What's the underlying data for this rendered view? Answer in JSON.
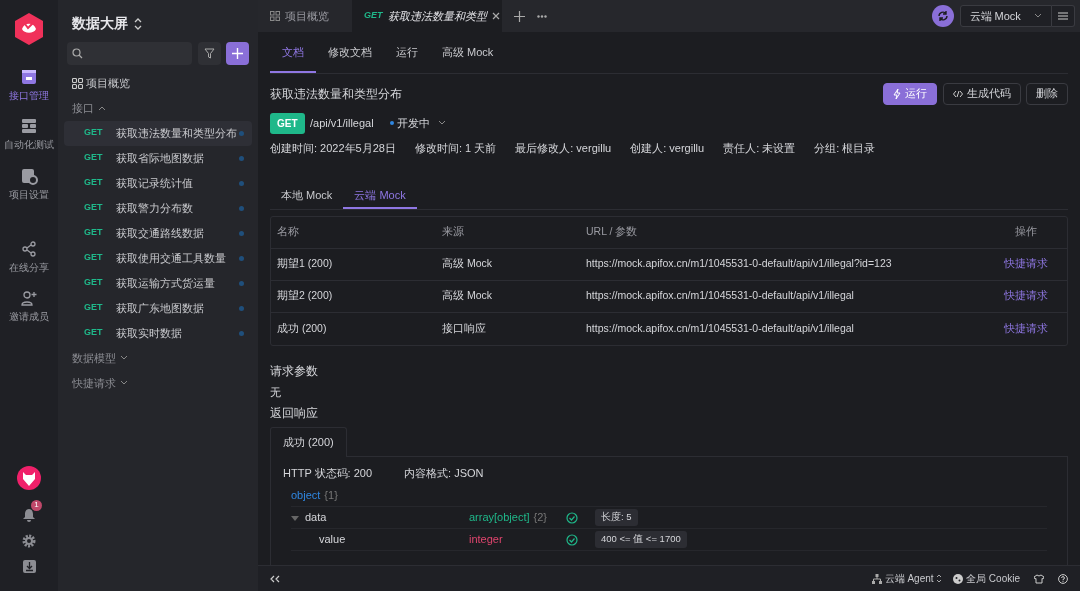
{
  "rail": {
    "items": [
      {
        "label": "接口管理",
        "selected": true
      },
      {
        "label": "自动化测试",
        "selected": false
      },
      {
        "label": "项目设置",
        "selected": false
      },
      {
        "label": "在线分享",
        "selected": false
      },
      {
        "label": "邀请成员",
        "selected": false
      }
    ],
    "notification_count": "1"
  },
  "sidebar": {
    "project": "数据大屏",
    "overview": "项目概览",
    "groups": [
      {
        "label": "接口",
        "expanded": true,
        "items": [
          {
            "method": "GET",
            "name": "获取违法数量和类型分布",
            "selected": true
          },
          {
            "method": "GET",
            "name": "获取省际地图数据",
            "selected": false
          },
          {
            "method": "GET",
            "name": "获取记录统计值",
            "selected": false
          },
          {
            "method": "GET",
            "name": "获取警力分布数",
            "selected": false
          },
          {
            "method": "GET",
            "name": "获取交通路线数据",
            "selected": false
          },
          {
            "method": "GET",
            "name": "获取使用交通工具数量",
            "selected": false
          },
          {
            "method": "GET",
            "name": "获取运输方式货运量",
            "selected": false
          },
          {
            "method": "GET",
            "name": "获取广东地图数据",
            "selected": false
          },
          {
            "method": "GET",
            "name": "获取实时数据",
            "selected": false
          }
        ]
      },
      {
        "label": "数据模型",
        "expanded": false
      },
      {
        "label": "快捷请求",
        "expanded": false
      }
    ]
  },
  "top_tabs": [
    {
      "label": "项目概览",
      "selected": false
    },
    {
      "method": "GET",
      "label": "获取违法数量和类型",
      "selected": true
    }
  ],
  "environment": "云端 Mock",
  "doc_tabs": [
    {
      "label": "文档",
      "selected": true
    },
    {
      "label": "修改文档",
      "selected": false
    },
    {
      "label": "运行",
      "selected": false
    },
    {
      "label": "高级 Mock",
      "selected": false
    }
  ],
  "title": "获取违法数量和类型分布",
  "buttons": [
    {
      "label": "运行",
      "kind": "primary"
    },
    {
      "label": "生成代码",
      "kind": "code"
    },
    {
      "label": "删除",
      "kind": "plain"
    }
  ],
  "method": "GET",
  "path": "/api/v1/illegal",
  "status": "开发中",
  "meta": [
    "创建时间: 2022年5月28日",
    "修改时间: 1 天前",
    "最后修改人: vergillu",
    "创建人: vergillu",
    "责任人: 未设置",
    "分组: 根目录"
  ],
  "mock_tabs": [
    {
      "label": "本地 Mock",
      "selected": false
    },
    {
      "label": "云端 Mock",
      "selected": true
    }
  ],
  "table": {
    "columns": [
      "名称",
      "来源",
      "URL / 参数",
      "操作"
    ],
    "rows": [
      [
        "期望1 (200)",
        "高级 Mock",
        "https://mock.apifox.cn/m1/1045531-0-default/api/v1/illegal?id=123",
        "快捷请求"
      ],
      [
        "期望2 (200)",
        "高级 Mock",
        "https://mock.apifox.cn/m1/1045531-0-default/api/v1/illegal",
        "快捷请求"
      ],
      [
        "成功 (200)",
        "接口响应",
        "https://mock.apifox.cn/m1/1045531-0-default/api/v1/illegal",
        "快捷请求"
      ]
    ]
  },
  "request_params": {
    "heading": "请求参数",
    "value": "无"
  },
  "response": {
    "heading": "返回响应",
    "tabs": [
      {
        "label": "成功 (200)",
        "selected": true
      }
    ],
    "status_code": "HTTP 状态码: 200",
    "content_type": "内容格式: JSON",
    "schema": [
      {
        "name": "object",
        "count": "{1}",
        "kind": "root"
      },
      {
        "name": "data",
        "type": "array[object]",
        "count": "{2}",
        "kind": "array",
        "expanded": true,
        "tag": "长度: 5"
      },
      {
        "name": "value",
        "type": "integer",
        "kind": "integer",
        "tag": "400 <= 值 <= 1700"
      }
    ]
  },
  "status_bar": {
    "agent": "云端 Agent",
    "cookie": "全局 Cookie"
  }
}
